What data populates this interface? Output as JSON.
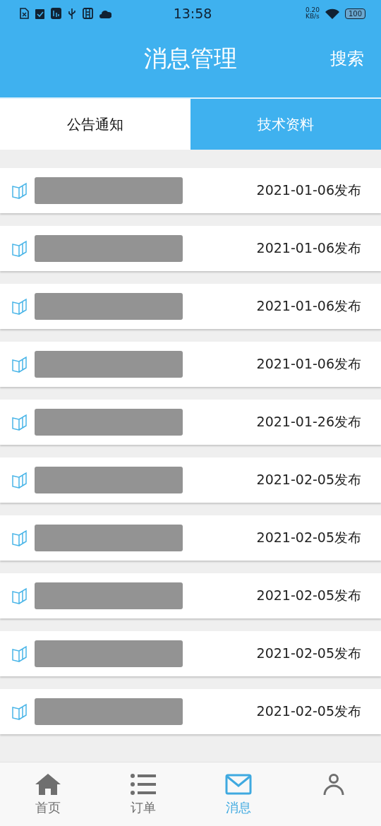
{
  "status_bar": {
    "time": "13:58",
    "speed": "0.20",
    "speed_unit": "KB/s",
    "battery": "100"
  },
  "header": {
    "title": "消息管理",
    "action": "搜索"
  },
  "tabs": [
    {
      "label": "公告通知",
      "selected": true
    },
    {
      "label": "技术资料",
      "selected": false
    }
  ],
  "notices": [
    {
      "date": "2021-01-06发布"
    },
    {
      "date": "2021-01-06发布"
    },
    {
      "date": "2021-01-06发布"
    },
    {
      "date": "2021-01-06发布"
    },
    {
      "date": "2021-01-26发布"
    },
    {
      "date": "2021-02-05发布"
    },
    {
      "date": "2021-02-05发布"
    },
    {
      "date": "2021-02-05发布"
    },
    {
      "date": "2021-02-05发布"
    },
    {
      "date": "2021-02-05发布"
    }
  ],
  "bottom_nav": [
    {
      "kind": "home",
      "label": "首页",
      "selected": false
    },
    {
      "kind": "list",
      "label": "订单",
      "selected": false
    },
    {
      "kind": "mail",
      "label": "消息",
      "selected": true
    },
    {
      "kind": "person",
      "selected": false
    }
  ]
}
